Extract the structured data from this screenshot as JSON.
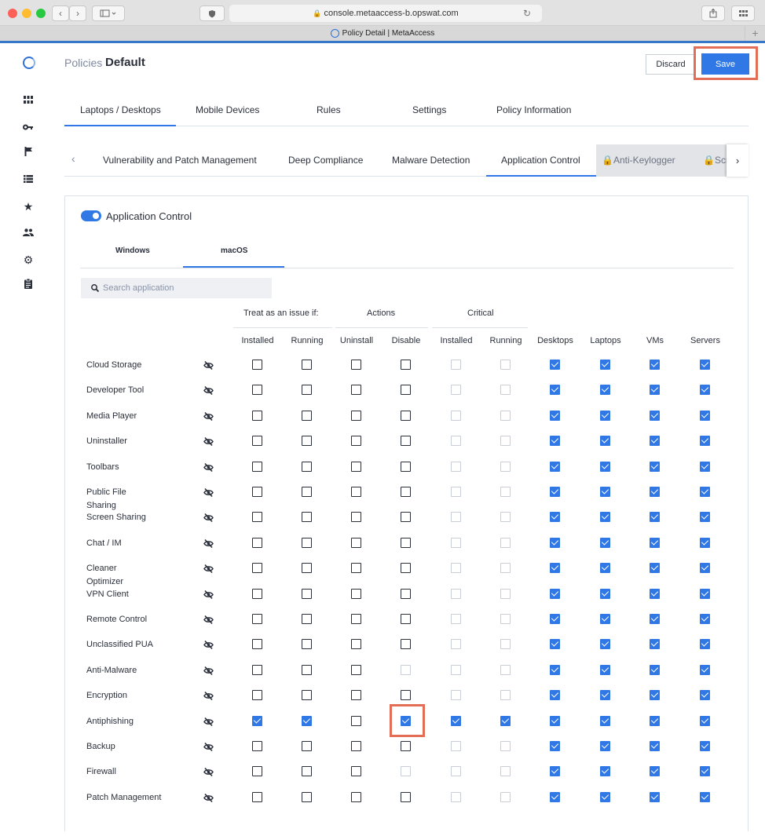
{
  "browser": {
    "url": "console.metaaccess-b.opswat.com",
    "tab_title": "Policy Detail | MetaAccess",
    "colors": {
      "red": "#fe5f57",
      "yellow": "#febc2e",
      "green": "#28c840"
    }
  },
  "sidebar": {
    "icons": [
      "dashboard-icon",
      "key-icon",
      "flag-icon",
      "list-icon",
      "star-icon",
      "users-icon",
      "gear-icon",
      "clipboard-icon"
    ]
  },
  "header": {
    "breadcrumb": "Policies",
    "title": "Default",
    "discard_label": "Discard",
    "save_label": "Save"
  },
  "main_tabs": [
    "Laptops / Desktops",
    "Mobile Devices",
    "Rules",
    "Settings",
    "Policy Information"
  ],
  "sub_tabs": [
    "Vulnerability and Patch Management",
    "Deep Compliance",
    "Malware Detection",
    "Application Control"
  ],
  "sub_tabs_locked": [
    "Anti-Keylogger",
    "Scr"
  ],
  "panel": {
    "toggle_label": "Application Control",
    "toggle_on": true,
    "os_tabs": [
      "Windows",
      "macOS"
    ],
    "search_placeholder": "Search application"
  },
  "table": {
    "groups": [
      "Treat as an issue if:",
      "Actions",
      "Critical"
    ],
    "columns": [
      "Installed",
      "Running",
      "Uninstall",
      "Disable",
      "Installed",
      "Running",
      "Desktops",
      "Laptops",
      "VMs",
      "Servers"
    ],
    "rows": [
      {
        "name": "Cloud Storage",
        "checks": [
          "u",
          "u",
          "u",
          "u",
          "d",
          "d",
          "c",
          "c",
          "c",
          "c"
        ]
      },
      {
        "name": "Developer Tool",
        "checks": [
          "u",
          "u",
          "u",
          "u",
          "d",
          "d",
          "c",
          "c",
          "c",
          "c"
        ]
      },
      {
        "name": "Media Player",
        "checks": [
          "u",
          "u",
          "u",
          "u",
          "d",
          "d",
          "c",
          "c",
          "c",
          "c"
        ]
      },
      {
        "name": "Uninstaller",
        "checks": [
          "u",
          "u",
          "u",
          "u",
          "d",
          "d",
          "c",
          "c",
          "c",
          "c"
        ]
      },
      {
        "name": "Toolbars",
        "checks": [
          "u",
          "u",
          "u",
          "u",
          "d",
          "d",
          "c",
          "c",
          "c",
          "c"
        ]
      },
      {
        "name": "Public File Sharing",
        "checks": [
          "u",
          "u",
          "u",
          "u",
          "d",
          "d",
          "c",
          "c",
          "c",
          "c"
        ]
      },
      {
        "name": "Screen Sharing",
        "checks": [
          "u",
          "u",
          "u",
          "u",
          "d",
          "d",
          "c",
          "c",
          "c",
          "c"
        ]
      },
      {
        "name": "Chat / IM",
        "checks": [
          "u",
          "u",
          "u",
          "u",
          "d",
          "d",
          "c",
          "c",
          "c",
          "c"
        ]
      },
      {
        "name": "Cleaner Optimizer",
        "checks": [
          "u",
          "u",
          "u",
          "u",
          "d",
          "d",
          "c",
          "c",
          "c",
          "c"
        ]
      },
      {
        "name": "VPN Client",
        "checks": [
          "u",
          "u",
          "u",
          "u",
          "d",
          "d",
          "c",
          "c",
          "c",
          "c"
        ]
      },
      {
        "name": "Remote Control",
        "checks": [
          "u",
          "u",
          "u",
          "u",
          "d",
          "d",
          "c",
          "c",
          "c",
          "c"
        ]
      },
      {
        "name": "Unclassified PUA",
        "checks": [
          "u",
          "u",
          "u",
          "u",
          "d",
          "d",
          "c",
          "c",
          "c",
          "c"
        ]
      },
      {
        "name": "Anti-Malware",
        "checks": [
          "u",
          "u",
          "u",
          "d",
          "d",
          "d",
          "c",
          "c",
          "c",
          "c"
        ]
      },
      {
        "name": "Encryption",
        "checks": [
          "u",
          "u",
          "u",
          "u",
          "d",
          "d",
          "c",
          "c",
          "c",
          "c"
        ]
      },
      {
        "name": "Antiphishing",
        "checks": [
          "c",
          "c",
          "u",
          "c",
          "c",
          "c",
          "c",
          "c",
          "c",
          "c"
        ]
      },
      {
        "name": "Backup",
        "checks": [
          "u",
          "u",
          "u",
          "u",
          "d",
          "d",
          "c",
          "c",
          "c",
          "c"
        ]
      },
      {
        "name": "Firewall",
        "checks": [
          "u",
          "u",
          "u",
          "d",
          "d",
          "d",
          "c",
          "c",
          "c",
          "c"
        ]
      },
      {
        "name": "Patch Management",
        "checks": [
          "u",
          "u",
          "u",
          "u",
          "d",
          "d",
          "c",
          "c",
          "c",
          "c"
        ]
      }
    ]
  },
  "colors": {
    "accent": "#2f78e6",
    "highlight": "#e46d55"
  }
}
